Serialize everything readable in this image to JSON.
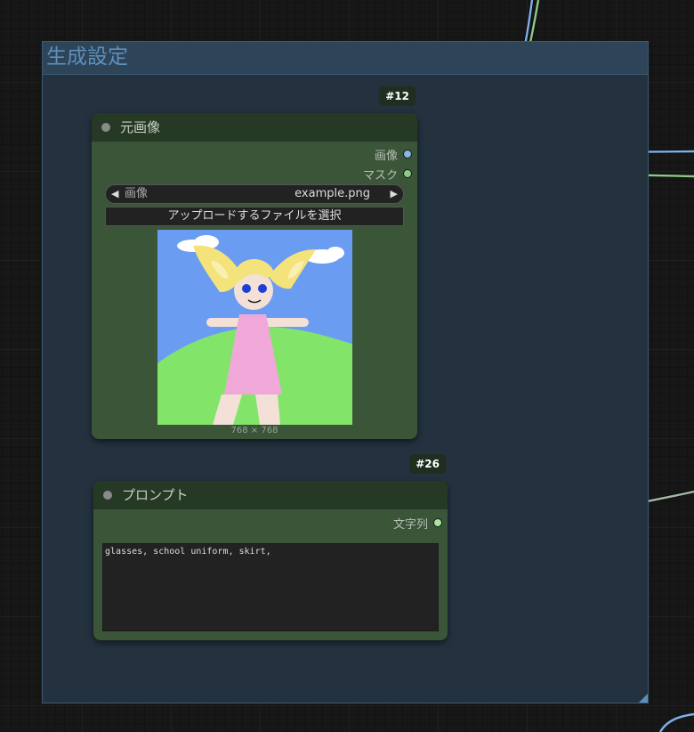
{
  "group": {
    "title": "生成設定"
  },
  "nodes": {
    "load_image": {
      "id": "#12",
      "title": "元画像",
      "outputs": [
        {
          "label": "画像",
          "color": "#8ab6e6"
        },
        {
          "label": "マスク",
          "color": "#8fc98a"
        }
      ],
      "combo": {
        "label": "画像",
        "value": "example.png",
        "prev_icon": "◀",
        "next_icon": "▶"
      },
      "upload_label": "アップロードするファイルを選択",
      "image_size": "768 × 768"
    },
    "prompt": {
      "id": "#26",
      "title": "プロンプト",
      "output": {
        "label": "文字列",
        "color": "#a9e59c"
      },
      "text": "glasses, school uniform, skirt,"
    }
  },
  "colors": {
    "image_wire": "#7fb0e8",
    "mask_wire": "#8fc98a",
    "string_wire": "#a4b8a6",
    "group_title": "#5e8fbb"
  }
}
